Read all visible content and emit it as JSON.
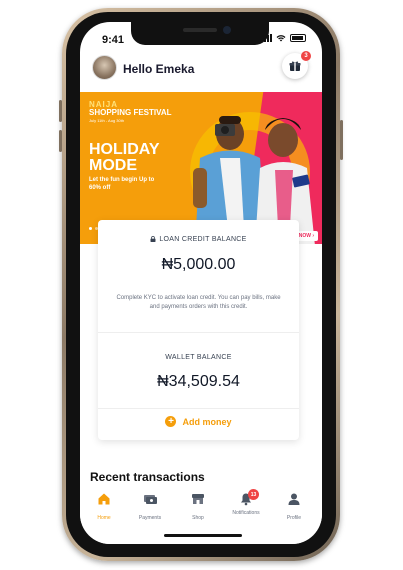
{
  "status_bar": {
    "time": "9:41"
  },
  "header": {
    "greeting": "Hello Emeka",
    "gift_badge": "3"
  },
  "banner": {
    "logo_line1": "NAIJA",
    "logo_line2": "SHOPPING FESTIVAL",
    "logo_dates": "July 11th - Aug 30th",
    "headline": "HOLIDAY MODE",
    "subtext": "Let the fun begin Up to 60% off",
    "shop_now": "SHOP NOW ›"
  },
  "loan_card": {
    "label": "LOAN CREDIT BALANCE",
    "amount": "₦5,000.00",
    "note": "Complete KYC to activate loan credit. You can pay bills, make and payments orders with this credit."
  },
  "wallet_card": {
    "label": "WALLET BALANCE",
    "amount": "₦34,509.54",
    "add_money": "Add money"
  },
  "recent_heading": "Recent transactions",
  "nav": {
    "home": "Home",
    "payments": "Payments",
    "shop": "Shop",
    "notifications": "Notifications",
    "notifications_badge": "13",
    "profile": "Profile"
  },
  "colors": {
    "accent": "#f59e0b",
    "magenta": "#ef2a5c",
    "badge": "#ef4444"
  }
}
